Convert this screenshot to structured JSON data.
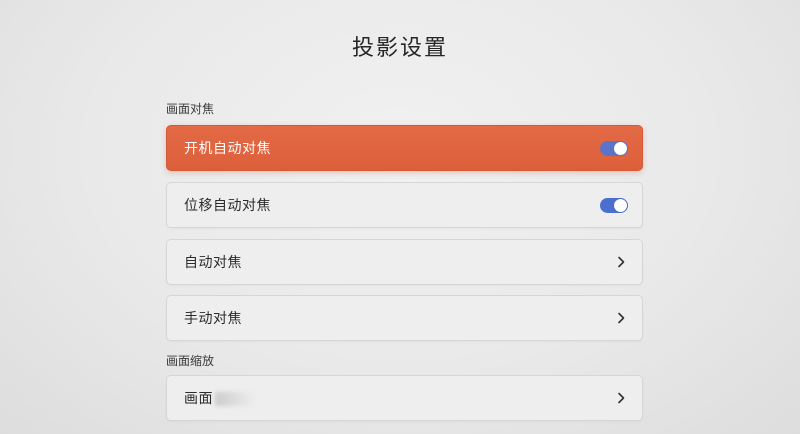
{
  "page_title": "投影设置",
  "sections": [
    {
      "label": "画面对焦",
      "rows": [
        {
          "label": "开机自动对焦",
          "control": "toggle",
          "on": true,
          "focused": true
        },
        {
          "label": "位移自动对焦",
          "control": "toggle",
          "on": true,
          "focused": false
        },
        {
          "label": "自动对焦",
          "control": "chevron",
          "focused": false
        },
        {
          "label": "手动对焦",
          "control": "chevron",
          "focused": false
        }
      ]
    },
    {
      "label": "画面缩放",
      "rows": [
        {
          "label": "画面",
          "control": "chevron",
          "focused": false
        }
      ]
    }
  ],
  "colors": {
    "focus_accent": "#dc5f3a",
    "toggle_on": "#4a6fcf",
    "row_background": "#eeeeee"
  },
  "icons": {
    "toggle": "toggle-switch-icon",
    "chevron": "chevron-right-icon"
  }
}
